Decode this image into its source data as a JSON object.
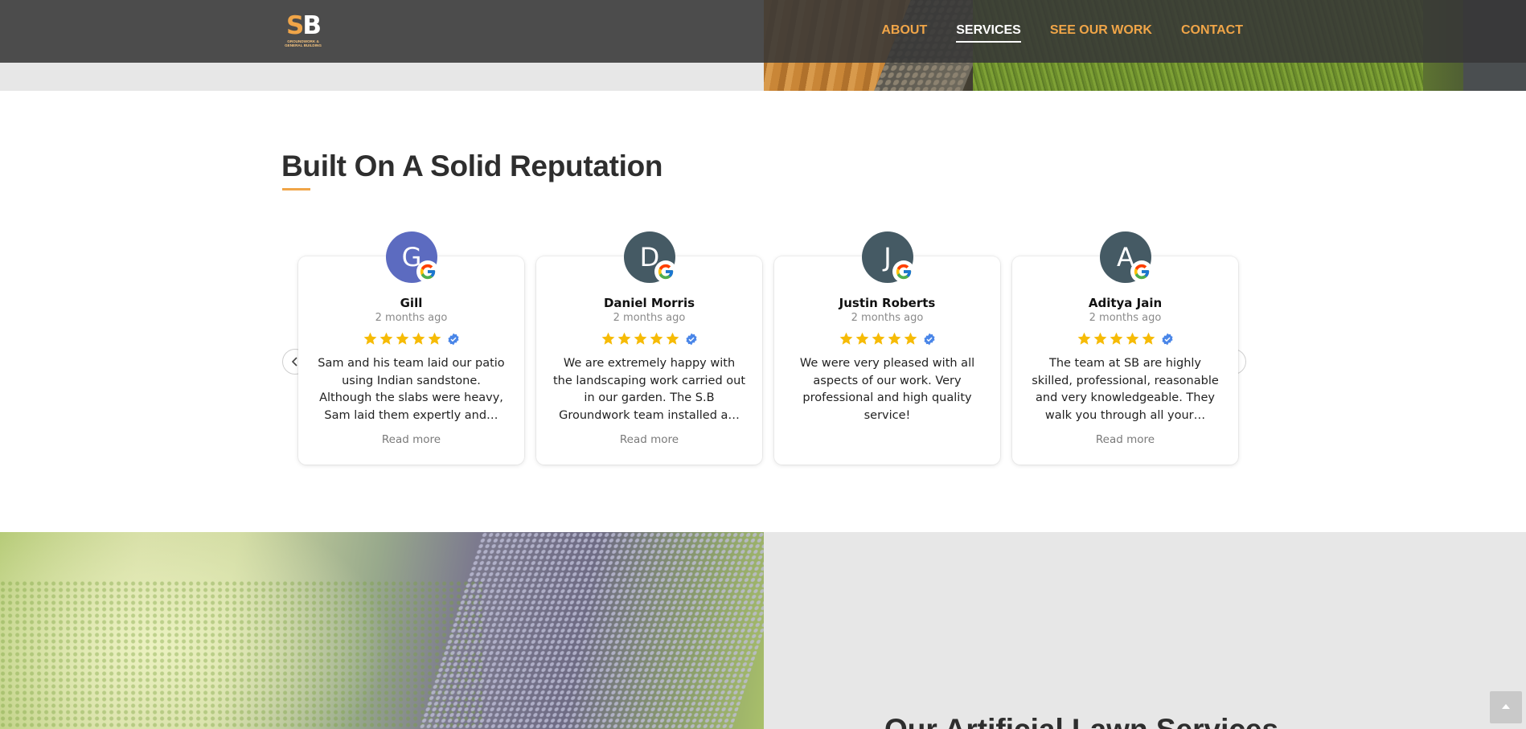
{
  "brand": {
    "logo_text_s": "S",
    "logo_text_b": "B",
    "logo_subtitle": "GROUNDWORK & GENERAL BUILDING",
    "accent_color": "#f0a548"
  },
  "nav": {
    "items": [
      {
        "label": "ABOUT",
        "active": false
      },
      {
        "label": "SERVICES",
        "active": true
      },
      {
        "label": "SEE OUR WORK",
        "active": false
      },
      {
        "label": "CONTACT",
        "active": false
      }
    ]
  },
  "reviews_section": {
    "title": "Built On A Solid Reputation",
    "prev_icon": "chevron-left-icon",
    "next_icon": "chevron-right-icon",
    "reviews": [
      {
        "initial": "G",
        "avatar_color": "#5c6bc0",
        "name": "Gill",
        "date": "2 months ago",
        "rating": 5,
        "text": "Sam and his team laid our patio using Indian sandstone. Although the slabs were heavy, Sam laid them expertly and…",
        "read_more": "Read more"
      },
      {
        "initial": "D",
        "avatar_color": "#455a64",
        "name": "Daniel Morris",
        "date": "2 months ago",
        "rating": 5,
        "text": "We are extremely happy with the landscaping work carried out in our garden. The S.B Groundwork team installed a…",
        "read_more": "Read more"
      },
      {
        "initial": "J",
        "avatar_color": "#455a64",
        "name": "Justin Roberts",
        "date": "2 months ago",
        "rating": 5,
        "text": "We were very pleased with all aspects of our work. Very professional and high quality service!",
        "read_more": ""
      },
      {
        "initial": "A",
        "avatar_color": "#455a64",
        "name": "Aditya Jain",
        "date": "2 months ago",
        "rating": 5,
        "text": "The team at SB are highly skilled, professional, reasonable and very knowledgeable. They walk you through all your…",
        "read_more": "Read more"
      }
    ]
  },
  "services_section": {
    "title": "Our Artificial Lawn Services"
  },
  "scroll_top_icon": "arrow-up-icon"
}
